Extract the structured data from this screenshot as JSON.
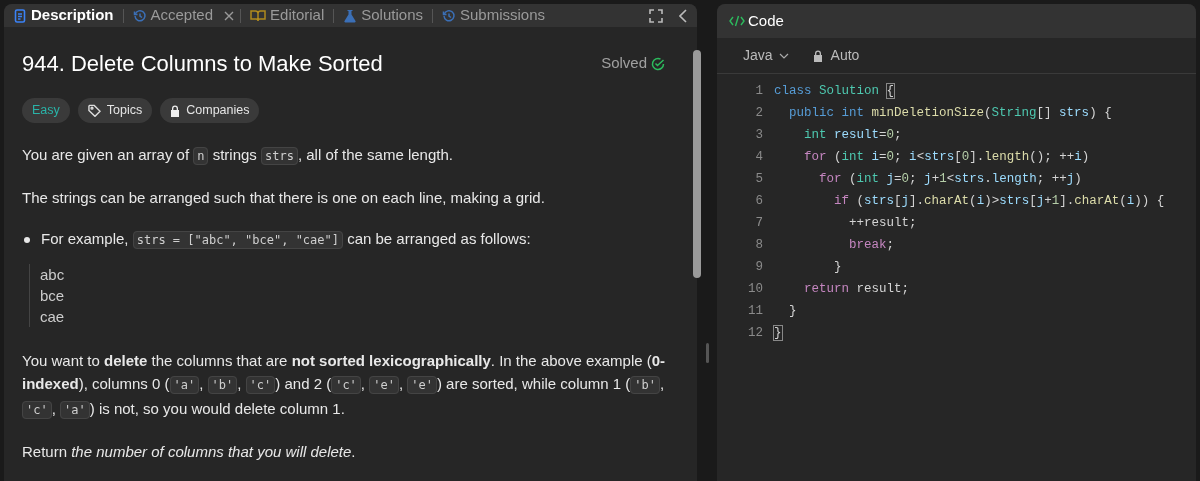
{
  "tabs": [
    {
      "label": "Description",
      "selected": true,
      "closable": false
    },
    {
      "label": "Accepted",
      "selected": false,
      "closable": true
    },
    {
      "label": "Editorial",
      "selected": false,
      "closable": false
    },
    {
      "label": "Solutions",
      "selected": false,
      "closable": false
    },
    {
      "label": "Submissions",
      "selected": false,
      "closable": false
    }
  ],
  "problem": {
    "title": "944. Delete Columns to Make Sorted",
    "status": "Solved",
    "tags": [
      {
        "label": "Easy",
        "kind": "difficulty"
      },
      {
        "label": "Topics",
        "kind": "topics"
      },
      {
        "label": "Companies",
        "kind": "companies"
      }
    ]
  },
  "description": [
    {
      "kind": "paragraph",
      "segments": [
        {
          "kind": "text",
          "text": "You are given an array of "
        },
        {
          "kind": "code",
          "text": "n"
        },
        {
          "kind": "text",
          "text": " strings "
        },
        {
          "kind": "code",
          "text": "strs"
        },
        {
          "kind": "text",
          "text": ", all of the same length."
        }
      ]
    },
    {
      "kind": "paragraph",
      "segments": [
        {
          "kind": "text",
          "text": "The strings can be arranged such that there is one on each line, making a grid."
        }
      ]
    },
    {
      "kind": "bullet",
      "segments": [
        {
          "kind": "text",
          "text": "For example, "
        },
        {
          "kind": "code",
          "text": "strs = [\"abc\", \"bce\", \"cae\"]"
        },
        {
          "kind": "text",
          "text": " can be arranged as follows:"
        }
      ]
    },
    {
      "kind": "example",
      "lines": [
        "abc",
        "bce",
        "cae"
      ]
    },
    {
      "kind": "paragraph",
      "segments": [
        {
          "kind": "text",
          "text": "You want to **delete** the columns that are **not sorted lexicographically**. In the above example (**0-indexed**), columns 0 ("
        },
        {
          "kind": "code",
          "text": "'a'"
        },
        {
          "kind": "text",
          "text": ", "
        },
        {
          "kind": "code",
          "text": "'b'"
        },
        {
          "kind": "text",
          "text": ", "
        },
        {
          "kind": "code",
          "text": "'c'"
        },
        {
          "kind": "text",
          "text": ") and 2 ("
        },
        {
          "kind": "code",
          "text": "'c'"
        },
        {
          "kind": "text",
          "text": ", "
        },
        {
          "kind": "code",
          "text": "'e'"
        },
        {
          "kind": "text",
          "text": ", "
        },
        {
          "kind": "code",
          "text": "'e'"
        },
        {
          "kind": "text",
          "text": ") are sorted, while column 1 ("
        },
        {
          "kind": "code",
          "text": "'b'"
        },
        {
          "kind": "text",
          "text": ", "
        },
        {
          "kind": "code",
          "text": "'c'"
        },
        {
          "kind": "text",
          "text": ", "
        },
        {
          "kind": "code",
          "text": "'a'"
        },
        {
          "kind": "text",
          "text": ") is not, so you would delete column 1."
        }
      ]
    },
    {
      "kind": "paragraph",
      "segments": [
        {
          "kind": "text",
          "text": "Return *the number of columns that you will delete*."
        }
      ]
    }
  ],
  "editor": {
    "title": "Code",
    "language": "Java",
    "mode": "Auto",
    "lines": [
      {
        "number": "1",
        "tokens": [
          {
            "kind": "keyword",
            "text": "class "
          },
          {
            "kind": "type",
            "text": "Solution "
          },
          {
            "kind": "match",
            "text": "{"
          }
        ]
      },
      {
        "number": "2",
        "tokens": [
          {
            "kind": "keyword",
            "text": "  public int "
          },
          {
            "kind": "function",
            "text": "minDeletionSize"
          },
          {
            "kind": "plain",
            "text": "("
          },
          {
            "kind": "type",
            "text": "String"
          },
          {
            "kind": "plain",
            "text": "[] "
          },
          {
            "kind": "variable",
            "text": "strs"
          },
          {
            "kind": "plain",
            "text": ") {"
          }
        ]
      },
      {
        "number": "3",
        "tokens": [
          {
            "kind": "type",
            "text": "    int "
          },
          {
            "kind": "variable",
            "text": "result"
          },
          {
            "kind": "plain",
            "text": "="
          },
          {
            "kind": "number",
            "text": "0"
          },
          {
            "kind": "plain",
            "text": ";"
          }
        ]
      },
      {
        "number": "4",
        "tokens": [
          {
            "kind": "control",
            "text": "    for"
          },
          {
            "kind": "plain",
            "text": " ("
          },
          {
            "kind": "type",
            "text": "int "
          },
          {
            "kind": "variable",
            "text": "i"
          },
          {
            "kind": "plain",
            "text": "="
          },
          {
            "kind": "number",
            "text": "0"
          },
          {
            "kind": "plain",
            "text": "; "
          },
          {
            "kind": "variable",
            "text": "i"
          },
          {
            "kind": "plain",
            "text": "<"
          },
          {
            "kind": "variable",
            "text": "strs"
          },
          {
            "kind": "plain",
            "text": "["
          },
          {
            "kind": "number",
            "text": "0"
          },
          {
            "kind": "plain",
            "text": "]."
          },
          {
            "kind": "function",
            "text": "length"
          },
          {
            "kind": "plain",
            "text": "(); ++"
          },
          {
            "kind": "variable",
            "text": "i"
          },
          {
            "kind": "plain",
            "text": ")"
          }
        ]
      },
      {
        "number": "5",
        "tokens": [
          {
            "kind": "control",
            "text": "      for"
          },
          {
            "kind": "plain",
            "text": " ("
          },
          {
            "kind": "type",
            "text": "int "
          },
          {
            "kind": "variable",
            "text": "j"
          },
          {
            "kind": "plain",
            "text": "="
          },
          {
            "kind": "number",
            "text": "0"
          },
          {
            "kind": "plain",
            "text": "; "
          },
          {
            "kind": "variable",
            "text": "j"
          },
          {
            "kind": "plain",
            "text": "+"
          },
          {
            "kind": "number",
            "text": "1"
          },
          {
            "kind": "plain",
            "text": "<"
          },
          {
            "kind": "variable",
            "text": "strs"
          },
          {
            "kind": "plain",
            "text": "."
          },
          {
            "kind": "variable",
            "text": "length"
          },
          {
            "kind": "plain",
            "text": "; ++"
          },
          {
            "kind": "variable",
            "text": "j"
          },
          {
            "kind": "plain",
            "text": ")"
          }
        ]
      },
      {
        "number": "6",
        "tokens": [
          {
            "kind": "control",
            "text": "        if"
          },
          {
            "kind": "plain",
            "text": " ("
          },
          {
            "kind": "variable",
            "text": "strs"
          },
          {
            "kind": "plain",
            "text": "["
          },
          {
            "kind": "variable",
            "text": "j"
          },
          {
            "kind": "plain",
            "text": "]."
          },
          {
            "kind": "function",
            "text": "charAt"
          },
          {
            "kind": "plain",
            "text": "("
          },
          {
            "kind": "variable",
            "text": "i"
          },
          {
            "kind": "plain",
            "text": ")>"
          },
          {
            "kind": "variable",
            "text": "strs"
          },
          {
            "kind": "plain",
            "text": "["
          },
          {
            "kind": "variable",
            "text": "j"
          },
          {
            "kind": "plain",
            "text": "+"
          },
          {
            "kind": "number",
            "text": "1"
          },
          {
            "kind": "plain",
            "text": "]."
          },
          {
            "kind": "function",
            "text": "charAt"
          },
          {
            "kind": "plain",
            "text": "("
          },
          {
            "kind": "variable",
            "text": "i"
          },
          {
            "kind": "plain",
            "text": ")) {"
          }
        ]
      },
      {
        "number": "7",
        "tokens": [
          {
            "kind": "plain",
            "text": "          ++result;"
          }
        ]
      },
      {
        "number": "8",
        "tokens": [
          {
            "kind": "control",
            "text": "          break"
          },
          {
            "kind": "plain",
            "text": ";"
          }
        ]
      },
      {
        "number": "9",
        "tokens": [
          {
            "kind": "plain",
            "text": "        }"
          }
        ]
      },
      {
        "number": "10",
        "tokens": [
          {
            "kind": "control",
            "text": "    return"
          },
          {
            "kind": "plain",
            "text": " result;"
          }
        ]
      },
      {
        "number": "11",
        "tokens": [
          {
            "kind": "plain",
            "text": "  }"
          }
        ]
      },
      {
        "number": "12",
        "tokens": [
          {
            "kind": "match",
            "text": "}"
          }
        ]
      }
    ]
  }
}
